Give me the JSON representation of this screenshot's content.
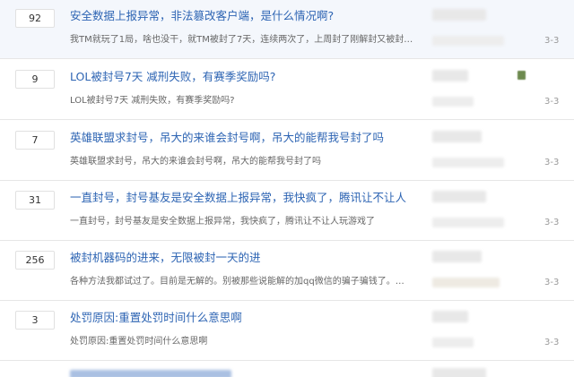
{
  "threads": [
    {
      "replies": "92",
      "title": "安全数据上报异常，非法篡改客户端，是什么情况啊?",
      "abstract": "我TM就玩了1局，啥也没干，就TM被封了7天，连续两次了，上周封了刚解封又被封…",
      "time": "3-3"
    },
    {
      "replies": "9",
      "title": "LOL被封号7天 减刑失败，有赛季奖励吗?",
      "abstract": "LOL被封号7天 减刑失败，有赛季奖励吗?",
      "time": "3-3"
    },
    {
      "replies": "7",
      "title": "英雄联盟求封号，吊大的来谁会封号啊，吊大的能帮我号封了吗",
      "abstract": "英雄联盟求封号，吊大的来谁会封号啊，吊大的能帮我号封了吗",
      "time": "3-3"
    },
    {
      "replies": "31",
      "title": "一直封号，封号基友是安全数据上报异常，我快疯了，腾讯让不让人",
      "abstract": "一直封号，封号基友是安全数据上报异常，我快疯了，腾讯让不让人玩游戏了",
      "time": "3-3"
    },
    {
      "replies": "256",
      "title": "被封机器码的进来，无限被封一天的进",
      "abstract": "各种方法我都试过了。目前是无解的。别被那些说能解的加qq微信的骗子骗钱了。…",
      "time": "3-3"
    },
    {
      "replies": "3",
      "title": "处罚原因:重置处罚时间什么意思啊",
      "abstract": "处罚原因:重置处罚时间什么意思啊",
      "time": "3-3"
    }
  ]
}
